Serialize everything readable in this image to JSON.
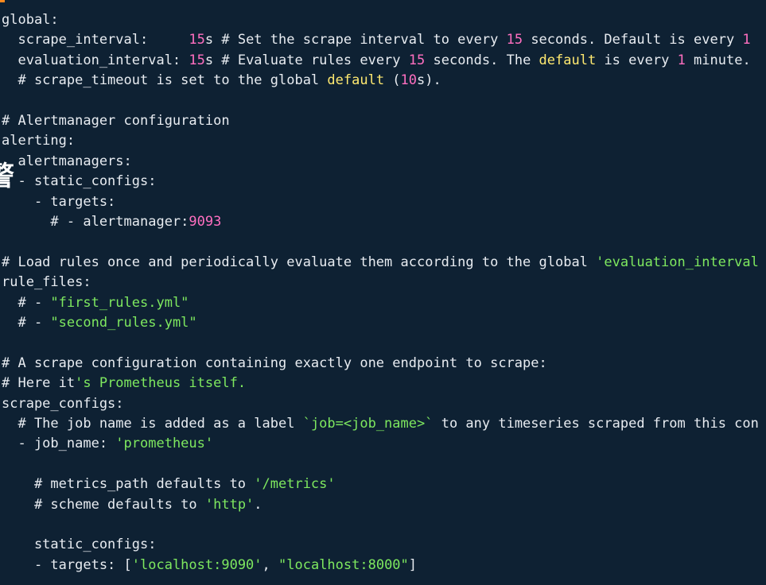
{
  "colors": {
    "background": "#0e2133",
    "text": "#e8ecf1",
    "number": "#ff6fc0",
    "string": "#7ee85f",
    "keyword": "#ffe970",
    "cursor": "#ff8a1e"
  },
  "overlay_glyph": "警",
  "lines": [
    [
      {
        "t": "global:",
        "c": "text"
      }
    ],
    [
      {
        "t": "  scrape_interval:     ",
        "c": "text"
      },
      {
        "t": "15",
        "c": "num"
      },
      {
        "t": "s # Set the scrape interval to every ",
        "c": "text"
      },
      {
        "t": "15",
        "c": "num"
      },
      {
        "t": " seconds. Default is every ",
        "c": "text"
      },
      {
        "t": "1",
        "c": "num"
      }
    ],
    [
      {
        "t": "  evaluation_interval: ",
        "c": "text"
      },
      {
        "t": "15",
        "c": "num"
      },
      {
        "t": "s # Evaluate rules every ",
        "c": "text"
      },
      {
        "t": "15",
        "c": "num"
      },
      {
        "t": " seconds. The ",
        "c": "text"
      },
      {
        "t": "default",
        "c": "yel"
      },
      {
        "t": " is every ",
        "c": "text"
      },
      {
        "t": "1",
        "c": "num"
      },
      {
        "t": " minute.",
        "c": "text"
      }
    ],
    [
      {
        "t": "  # scrape_timeout is set to the global ",
        "c": "text"
      },
      {
        "t": "default",
        "c": "yel"
      },
      {
        "t": " (",
        "c": "text"
      },
      {
        "t": "10",
        "c": "num"
      },
      {
        "t": "s).",
        "c": "text"
      }
    ],
    [
      {
        "t": "",
        "c": "text"
      }
    ],
    [
      {
        "t": "# Alertmanager configuration",
        "c": "text"
      }
    ],
    [
      {
        "t": "alerting:",
        "c": "text"
      }
    ],
    [
      {
        "t": "  alertmanagers:",
        "c": "text"
      }
    ],
    [
      {
        "t": "  - static_configs:",
        "c": "text"
      }
    ],
    [
      {
        "t": "    - targets:",
        "c": "text"
      }
    ],
    [
      {
        "t": "      # - alertmanager:",
        "c": "text"
      },
      {
        "t": "9093",
        "c": "num"
      }
    ],
    [
      {
        "t": "",
        "c": "text"
      }
    ],
    [
      {
        "t": "# Load rules once and periodically evaluate them according to the global ",
        "c": "text"
      },
      {
        "t": "'evaluation_interval",
        "c": "str"
      }
    ],
    [
      {
        "t": "rule_files:",
        "c": "text"
      }
    ],
    [
      {
        "t": "  # - ",
        "c": "text"
      },
      {
        "t": "\"first_rules.yml\"",
        "c": "str"
      }
    ],
    [
      {
        "t": "  # - ",
        "c": "text"
      },
      {
        "t": "\"second_rules.yml\"",
        "c": "str"
      }
    ],
    [
      {
        "t": "",
        "c": "text"
      }
    ],
    [
      {
        "t": "# A scrape configuration containing exactly one endpoint to scrape:",
        "c": "text"
      }
    ],
    [
      {
        "t": "# Here it",
        "c": "text"
      },
      {
        "t": "'s Prometheus itself.",
        "c": "str"
      }
    ],
    [
      {
        "t": "scrape_configs:",
        "c": "text"
      }
    ],
    [
      {
        "t": "  # The job name is added as a label ",
        "c": "text"
      },
      {
        "t": "`job=<job_name>`",
        "c": "str"
      },
      {
        "t": " to any timeseries scraped from this con",
        "c": "text"
      }
    ],
    [
      {
        "t": "  - job_name: ",
        "c": "text"
      },
      {
        "t": "'prometheus'",
        "c": "str"
      }
    ],
    [
      {
        "t": "",
        "c": "text"
      }
    ],
    [
      {
        "t": "    # metrics_path defaults to ",
        "c": "text"
      },
      {
        "t": "'/metrics'",
        "c": "str"
      }
    ],
    [
      {
        "t": "    # scheme defaults to ",
        "c": "text"
      },
      {
        "t": "'http'",
        "c": "str"
      },
      {
        "t": ".",
        "c": "text"
      }
    ],
    [
      {
        "t": "",
        "c": "text"
      }
    ],
    [
      {
        "t": "    static_configs:",
        "c": "text"
      }
    ],
    [
      {
        "t": "    - targets: [",
        "c": "text"
      },
      {
        "t": "'localhost:9090'",
        "c": "str"
      },
      {
        "t": ", ",
        "c": "text"
      },
      {
        "t": "\"localhost:8000\"",
        "c": "str"
      },
      {
        "t": "]",
        "c": "text"
      }
    ]
  ]
}
